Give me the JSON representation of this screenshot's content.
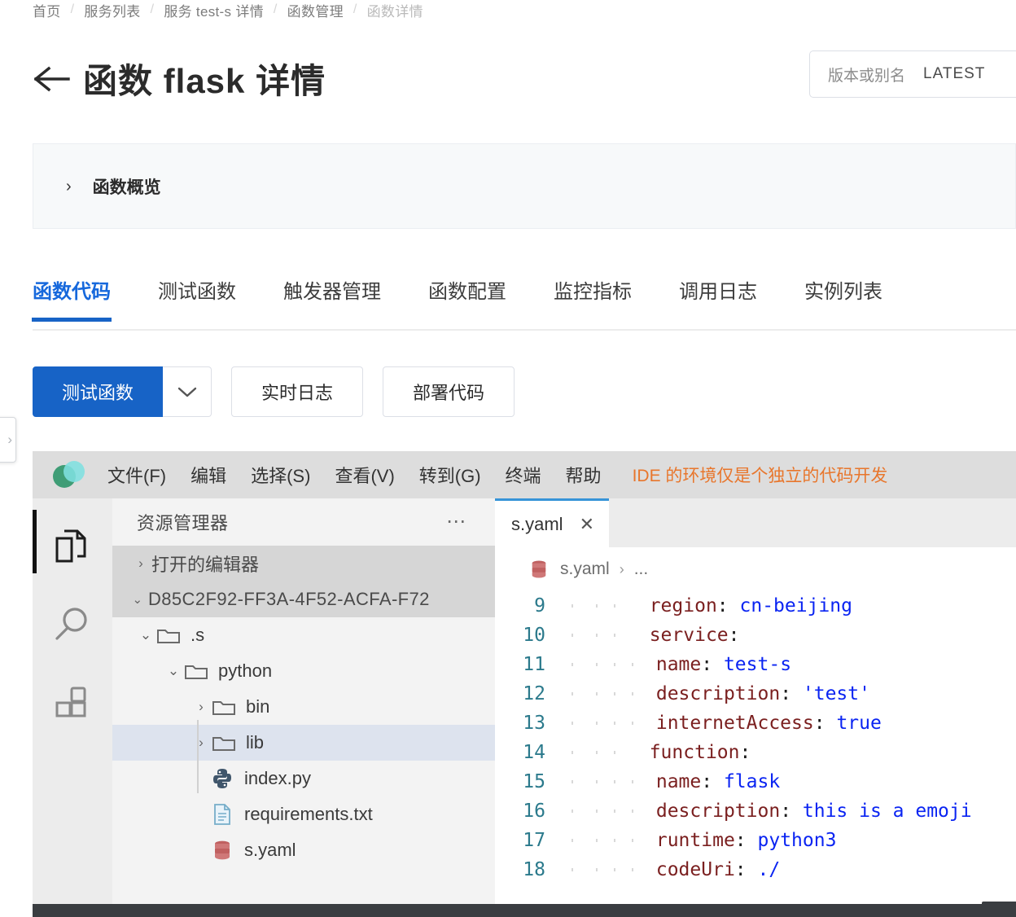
{
  "breadcrumb": {
    "items": [
      {
        "label": "首页"
      },
      {
        "label": "服务列表"
      },
      {
        "label": "服务 test-s 详情"
      },
      {
        "label": "函数管理"
      },
      {
        "label": "函数详情"
      }
    ],
    "separator": "/"
  },
  "header": {
    "back_icon": "arrow-left-icon",
    "title": "函数 flask 详情",
    "version": {
      "label": "版本或别名",
      "value": "LATEST"
    }
  },
  "overview": {
    "chevron": "›",
    "label": "函数概览"
  },
  "tabs": [
    {
      "label": "函数代码",
      "active": true
    },
    {
      "label": "测试函数",
      "active": false
    },
    {
      "label": "触发器管理",
      "active": false
    },
    {
      "label": "函数配置",
      "active": false
    },
    {
      "label": "监控指标",
      "active": false
    },
    {
      "label": "调用日志",
      "active": false
    },
    {
      "label": "实例列表",
      "active": false
    }
  ],
  "toolbar": {
    "test_label": "测试函数",
    "caret": "⌄",
    "logs_label": "实时日志",
    "deploy_label": "部署代码"
  },
  "drawer": {
    "chevron": "›"
  },
  "ide": {
    "menus": [
      "文件(F)",
      "编辑",
      "选择(S)",
      "查看(V)",
      "转到(G)",
      "终端",
      "帮助"
    ],
    "notice": "IDE 的环境仅是个独立的代码开发",
    "activity_icons": [
      "files-icon",
      "search-icon",
      "extensions-icon"
    ],
    "sidebar": {
      "title": "资源管理器",
      "more": "⋯",
      "open_editors": {
        "chevron": "›",
        "label": "打开的编辑器"
      },
      "root": {
        "chevron": "⌄",
        "label": "D85C2F92-FF3A-4F52-ACFA-F72"
      },
      "tree": [
        {
          "chevron": "⌄",
          "icon": "folder-icon",
          "label": ".s",
          "depth": 1,
          "selected": false
        },
        {
          "chevron": "⌄",
          "icon": "folder-icon",
          "label": "python",
          "depth": 2,
          "selected": false
        },
        {
          "chevron": "›",
          "icon": "folder-icon",
          "label": "bin",
          "depth": 3,
          "selected": false
        },
        {
          "chevron": "›",
          "icon": "folder-icon",
          "label": "lib",
          "depth": 3,
          "selected": true
        },
        {
          "chevron": "",
          "icon": "python-file-icon",
          "label": "index.py",
          "depth": 3,
          "selected": false
        },
        {
          "chevron": "",
          "icon": "text-file-icon",
          "label": "requirements.txt",
          "depth": 3,
          "selected": false
        },
        {
          "chevron": "",
          "icon": "yaml-file-icon",
          "label": "s.yaml",
          "depth": 3,
          "selected": false
        }
      ]
    },
    "editor": {
      "tab": {
        "label": "s.yaml",
        "close": "✕",
        "icon": "yaml-file-icon"
      },
      "breadcrumb": {
        "file": "s.yaml",
        "separator": "›",
        "rest": "..."
      },
      "lines": [
        {
          "no": "9",
          "indent": 1,
          "key": "region",
          "value": "cn-beijing"
        },
        {
          "no": "10",
          "indent": 1,
          "key": "service",
          "value": ""
        },
        {
          "no": "11",
          "indent": 2,
          "key": "name",
          "value": "test-s"
        },
        {
          "no": "12",
          "indent": 2,
          "key": "description",
          "value": "'test'"
        },
        {
          "no": "13",
          "indent": 2,
          "key": "internetAccess",
          "value": "true"
        },
        {
          "no": "14",
          "indent": 1,
          "key": "function",
          "value": ""
        },
        {
          "no": "15",
          "indent": 2,
          "key": "name",
          "value": "flask"
        },
        {
          "no": "16",
          "indent": 2,
          "key": "description",
          "value": "this is a emoji"
        },
        {
          "no": "17",
          "indent": 2,
          "key": "runtime",
          "value": "python3"
        },
        {
          "no": "18",
          "indent": 2,
          "key": "codeUri",
          "value": "./"
        }
      ]
    }
  },
  "colors": {
    "accent": "#1763c6",
    "tab_active": "#1668dc",
    "notice": "#e8762c",
    "yaml_key": "#7a1f1f",
    "yaml_value": "#0a24f2",
    "line_number": "#2b7a8c",
    "selection": "#dde3ee"
  }
}
